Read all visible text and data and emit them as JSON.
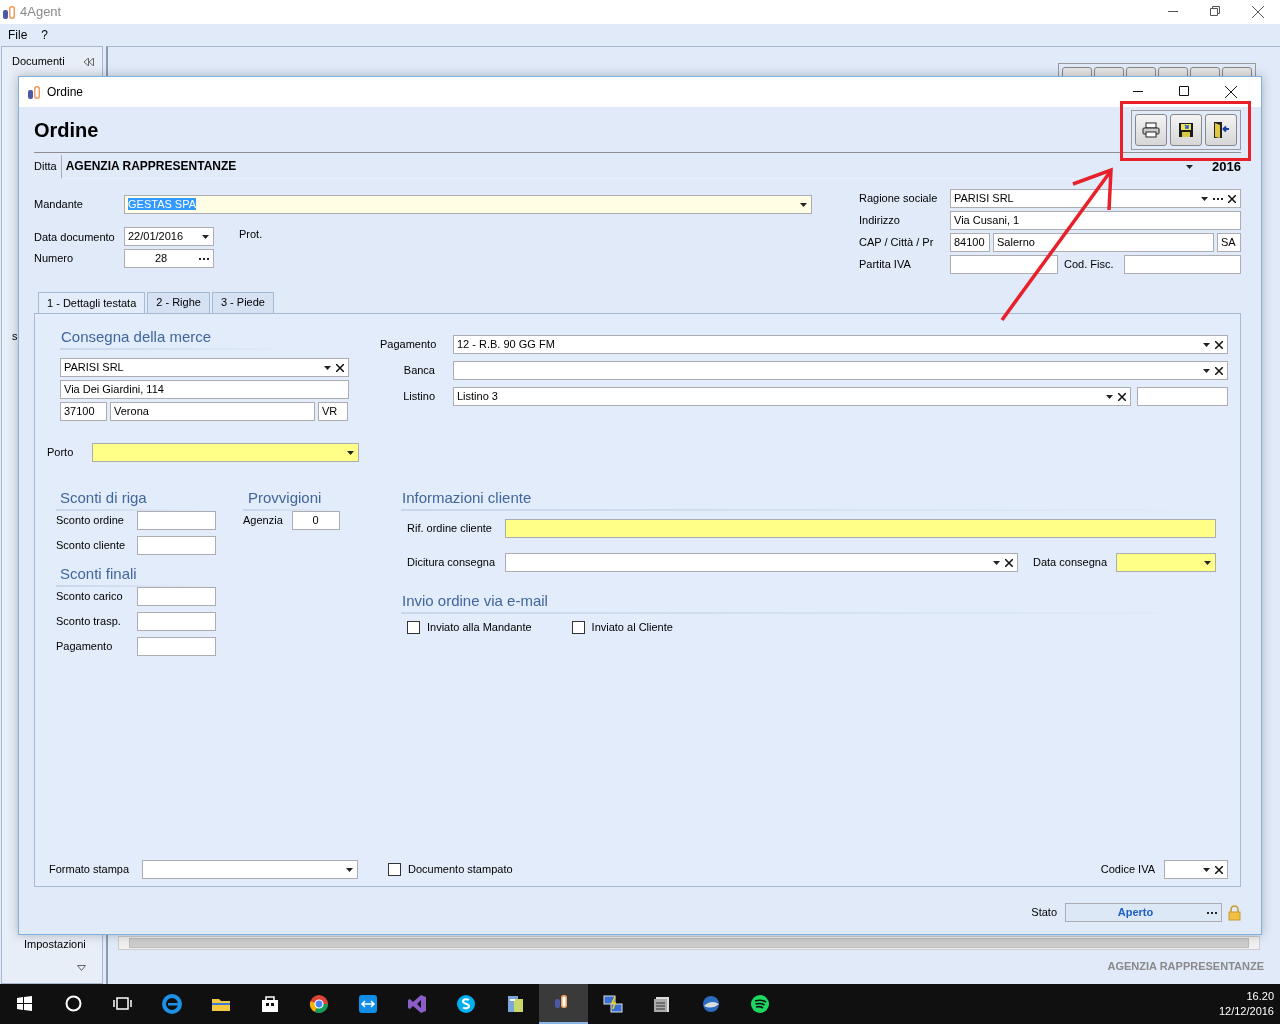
{
  "app": {
    "title": "4Agent",
    "menu": [
      "File",
      "?"
    ]
  },
  "sidebar": {
    "header": "Documenti",
    "fragment": "s",
    "footer": "Impostazioni"
  },
  "main": {
    "footer": "AGENZIA RAPPRESENTANZE"
  },
  "dialog": {
    "title": "Ordine",
    "heading": "Ordine",
    "ditta": {
      "label": "Ditta",
      "value": "AGENZIA RAPPRESENTANZE",
      "year": "2016"
    },
    "documento": [
      {
        "label": "Mandante",
        "value": "GESTAS SPA",
        "kind": "combo",
        "focused": true,
        "text_selected": true
      },
      {
        "label": "Data documento",
        "value": "22/01/2016",
        "kind": "combo"
      },
      {
        "label": "Numero",
        "value": "28",
        "kind": "dots",
        "centered": true
      }
    ],
    "prot": "Prot.",
    "cliente": {
      "ragione_sociale": {
        "label": "Ragione sociale",
        "value": "PARISI SRL",
        "kind": "lookup"
      },
      "indirizzo": {
        "label": "Indirizzo",
        "value": "Via Cusani, 1"
      },
      "citta": {
        "label": "CAP / Città / Pr",
        "cap": "84100",
        "citta": "Salerno",
        "provincia": "SA"
      },
      "partita_iva": {
        "label": "Partita IVA"
      },
      "cod_fisc": {
        "label": "Cod. Fisc."
      }
    },
    "tabs": [
      {
        "label": "1 - Dettagli testata",
        "selected": true
      },
      {
        "label": "2 - Righe",
        "selected": false
      },
      {
        "label": "3 - Piede",
        "selected": false
      }
    ],
    "consegna": {
      "heading": "Consegna della merce",
      "destinatario": {
        "value": "PARISI SRL",
        "kind": "combo-clear"
      },
      "indirizzo": "Via Dei Giardini, 114",
      "cap": "37100",
      "citta": "Verona",
      "provincia": "VR"
    },
    "porto": {
      "label": "Porto",
      "kind": "combo",
      "required": true
    },
    "pagamento": [
      {
        "label": "Pagamento",
        "value": "12 - R.B. 90 GG FM",
        "kind": "combo-clear"
      },
      {
        "label": "Banca",
        "kind": "combo-clear"
      },
      {
        "label": "Listino",
        "value": "Listino 3",
        "kind": "combo-clear",
        "side_field": true
      }
    ],
    "sconti_riga": {
      "heading": "Sconti di riga",
      "fields": [
        {
          "label": "Sconto ordine"
        },
        {
          "label": "Sconto cliente"
        }
      ]
    },
    "sconti_finali": {
      "heading": "Sconti finali",
      "fields": [
        {
          "label": "Sconto carico"
        },
        {
          "label": "Sconto trasp."
        },
        {
          "label": "Pagamento"
        }
      ]
    },
    "provvigioni": {
      "heading": "Provvigioni",
      "fields": [
        {
          "label": "Agenzia",
          "value": "0",
          "centered": true
        }
      ]
    },
    "informazioni_cliente": {
      "heading": "Informazioni cliente",
      "rif": {
        "label": "Rif. ordine cliente",
        "required": true
      },
      "dicitura": {
        "label": "Dicitura consegna",
        "kind": "combo-clear"
      },
      "data_consegna": {
        "label": "Data consegna",
        "kind": "combo",
        "required": true
      }
    },
    "invio_email": {
      "heading": "Invio ordine via e-mail",
      "options": [
        {
          "label": "Inviato alla Mandante",
          "checked": false
        },
        {
          "label": "Inviato al Cliente",
          "checked": false
        }
      ]
    },
    "formato_stampa": {
      "label": "Formato stampa",
      "kind": "combo"
    },
    "documento_stampato": {
      "label": "Documento stampato",
      "checked": false
    },
    "codice_iva": {
      "label": "Codice IVA",
      "kind": "combo-clear"
    },
    "stato": {
      "label": "Stato",
      "value": "Aperto",
      "kind": "dots",
      "locked": true
    }
  },
  "taskbar": {
    "time": "16.20",
    "date": "12/12/2016"
  }
}
